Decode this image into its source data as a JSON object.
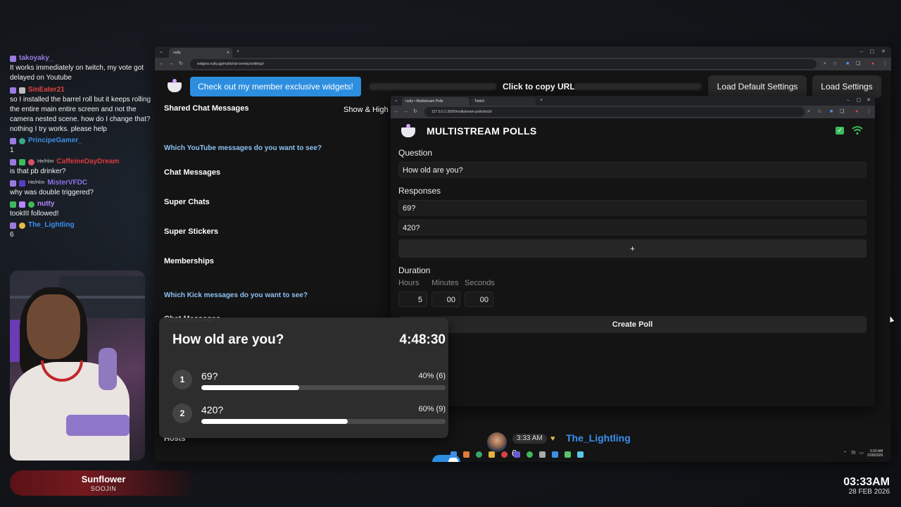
{
  "chat": [
    {
      "user": "takoyaky_",
      "color": "#9a7ae0",
      "pronoun": "",
      "text": "It works immediately on twitch, my vote got delayed on Youtube"
    },
    {
      "user": "SinEater21",
      "color": "#e04343",
      "pronoun": "",
      "text": "so I installed the barrel roll but it keeps rolling the entire main entire screen and not the camera nested scene. how do I change that? nothing I try works. please help"
    },
    {
      "user": "PrincipeGamer_",
      "color": "#3e8de6",
      "pronoun": "",
      "text": "1"
    },
    {
      "user": "CaffeineDayDream",
      "color": "#d93b3b",
      "pronoun": "He/Him",
      "text": "is that pb drinker?"
    },
    {
      "user": "MisterVFDC",
      "color": "#8a72e8",
      "pronoun": "He/Him",
      "text": "why was double triggered?"
    },
    {
      "user": "nutty",
      "color": "#b588ff",
      "pronoun": "",
      "text": "tookIII followed!"
    },
    {
      "user": "The_Lightling",
      "color": "#3b8ff0",
      "pronoun": "",
      "text": "6"
    }
  ],
  "song": {
    "title": "Sunflower",
    "artist": "SOOJIN"
  },
  "stream_clock": {
    "time": "03:33AM",
    "date": "28 FEB 2026"
  },
  "browser1": {
    "tab_title": "nutty",
    "url": "widgets.nutty.gg/multichat-overlay/settings/",
    "member_button": "Check out my member exclusive widgets!",
    "copy_url": "Click to copy URL",
    "load_default": "Load Default Settings",
    "load_settings": "Load Settings",
    "shared_chat": "Shared Chat Messages",
    "show_high": "Show & High",
    "youtube_q": "Which YouTube messages do you want to see?",
    "yt_items": [
      "Chat Messages",
      "Super Chats",
      "Super Stickers",
      "Memberships"
    ],
    "kick_q": "Which Kick messages do you want to see?",
    "kick_item": "Chat Messages",
    "hosts": "Hosts",
    "taskbar_time": "3:33 AM",
    "taskbar_date": "2/28/2026",
    "taskbar_temp": "70"
  },
  "bottom_message": {
    "time": "3:33 AM",
    "user": "The_Lightling",
    "text": "6"
  },
  "browser2": {
    "tab1": "nutty • Multistream Polls",
    "tab2": "Twitch",
    "url": "127.0.0.1:3000/multistream-polls/dock/",
    "title": "MULTISTREAM POLLS",
    "question_label": "Question",
    "question_value": "How old are you?",
    "responses_label": "Responses",
    "responses": [
      "69?",
      "420?"
    ],
    "add_label": "+",
    "duration_label": "Duration",
    "hours_label": "Hours",
    "minutes_label": "Minutes",
    "seconds_label": "Seconds",
    "hours": "5",
    "minutes": "00",
    "seconds": "00",
    "create_label": "Create Poll"
  },
  "poll": {
    "question": "How old are you?",
    "timer": "4:48:30",
    "options": [
      {
        "num": "1",
        "text": "69?",
        "pct_label": "40% (6)",
        "fraction": 0.4
      },
      {
        "num": "2",
        "text": "420?",
        "pct_label": "60% (9)",
        "fraction": 0.6
      }
    ]
  },
  "colors": {
    "accent": "#2d8ee0",
    "dock_link": "#8cc2f4",
    "lightling": "#3b8ff0"
  }
}
